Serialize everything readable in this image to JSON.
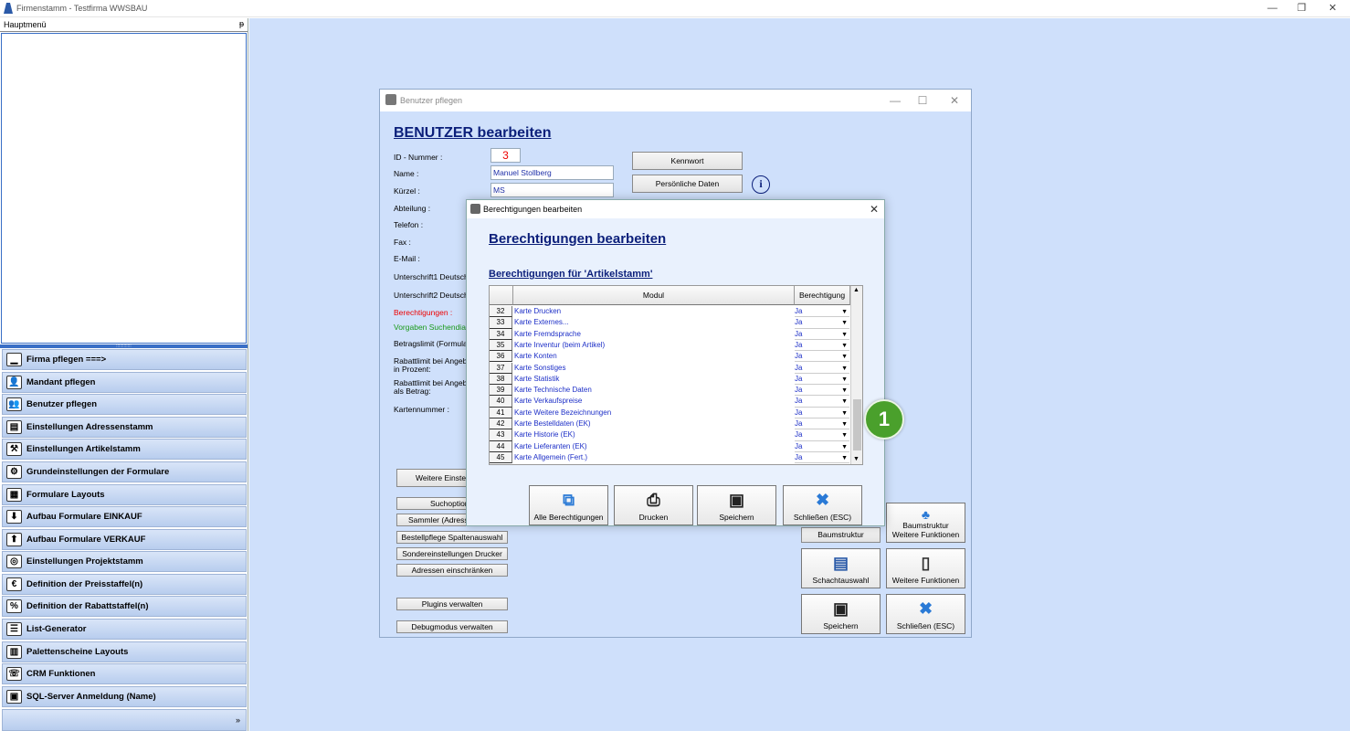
{
  "window": {
    "title": "Firmenstamm - Testfirma WWSBAU",
    "controls": [
      "—",
      "❐",
      "✕"
    ]
  },
  "left_panel": {
    "header": "Hauptmenü",
    "pin": "ᵽ",
    "grip": "::::::::::::",
    "items": [
      {
        "label": "Firma pflegen   ===>",
        "icon": "▁"
      },
      {
        "label": "Mandant pflegen",
        "icon": "👤"
      },
      {
        "label": "Benutzer pflegen",
        "icon": "👥"
      },
      {
        "label": "Einstellungen Adressenstamm",
        "icon": "▤"
      },
      {
        "label": "Einstellungen Artikelstamm",
        "icon": "⚒"
      },
      {
        "label": "Grundeinstellungen der Formulare",
        "icon": "⚙"
      },
      {
        "label": "Formulare Layouts",
        "icon": "▦"
      },
      {
        "label": "Aufbau Formulare EINKAUF",
        "icon": "⬇"
      },
      {
        "label": "Aufbau Formulare VERKAUF",
        "icon": "⬆"
      },
      {
        "label": "Einstellungen Projektstamm",
        "icon": "◎"
      },
      {
        "label": "Definition der Preisstaffel(n)",
        "icon": "€"
      },
      {
        "label": "Definition der Rabattstaffel(n)",
        "icon": "%"
      },
      {
        "label": "List-Generator",
        "icon": "☰"
      },
      {
        "label": "Palettenscheine Layouts",
        "icon": "▥"
      },
      {
        "label": "CRM Funktionen",
        "icon": "☏"
      },
      {
        "label": "SQL-Server Anmeldung (Name)",
        "icon": "▣"
      }
    ],
    "footer": "»"
  },
  "benutzer": {
    "title": "Benutzer pflegen",
    "heading": "BENUTZER bearbeiten",
    "labels": {
      "id": "ID - Nummer :",
      "name": "Name :",
      "kuerzel": "Kürzel :",
      "abteilung": "Abteilung :",
      "telefon": "Telefon :",
      "fax": "Fax :",
      "email": "E-Mail :",
      "unterschrift1": "Unterschrift1 Deutsch",
      "unterschrift2": "Unterschrift2 Deutsch",
      "berechtigungen": "Berechtigungen :",
      "vorgaben": "Vorgaben Suchendial",
      "betragslimit": "Betragslimit (Formulare",
      "rabatt1a": "Rabattlimit bei Angebo",
      "rabatt1b": "in Prozent:",
      "rabatt2a": "Rabattlimit bei Angebo",
      "rabatt2b": "als Betrag:",
      "karten": "Kartennummer :"
    },
    "values": {
      "id": "3",
      "name": "Manuel Stollberg",
      "kuerzel": "MS"
    },
    "buttons": {
      "kennwort": "Kennwort",
      "persoenlich": "Persönliche Daten",
      "weitere_einst": "Weitere Einstel",
      "suchoption": "Suchoption",
      "sammler": "Sammler (Adresse",
      "bestellpflege": "Bestellpflege Spaltenauswahl",
      "sondereinst": "Sondereinstellungen Drucker",
      "adressen": "Adressen einschränken",
      "plugins": "Plugins verwalten",
      "debug": "Debugmodus verwalten",
      "baumstruktur": "Baumstruktur",
      "baum_weitere_1": "Baumstruktur",
      "baum_weitere_2": "Weitere Funktionen",
      "schacht": "Schachtauswahl",
      "weitere_funk": "Weitere Funktionen",
      "speichern": "Speichern",
      "schliessen": "Schließen (ESC)"
    }
  },
  "dialog": {
    "title": "Berechtigungen bearbeiten",
    "heading": "Berechtigungen bearbeiten",
    "subheading": "Berechtigungen für 'Artikelstamm'",
    "columns": {
      "modul": "Modul",
      "berechtigung": "Berechtigung"
    },
    "rows": [
      {
        "nr": "32",
        "modul": "Karte Drucken",
        "perm": "Ja"
      },
      {
        "nr": "33",
        "modul": "Karte Externes...",
        "perm": "Ja"
      },
      {
        "nr": "34",
        "modul": "Karte Fremdsprache",
        "perm": "Ja"
      },
      {
        "nr": "35",
        "modul": "Karte Inventur (beim Artikel)",
        "perm": "Ja"
      },
      {
        "nr": "36",
        "modul": "Karte Konten",
        "perm": "Ja"
      },
      {
        "nr": "37",
        "modul": "Karte Sonstiges",
        "perm": "Ja"
      },
      {
        "nr": "38",
        "modul": "Karte Statistik",
        "perm": "Ja"
      },
      {
        "nr": "39",
        "modul": "Karte Technische Daten",
        "perm": "Ja"
      },
      {
        "nr": "40",
        "modul": "Karte Verkaufspreise",
        "perm": "Ja"
      },
      {
        "nr": "41",
        "modul": "Karte Weitere Bezeichnungen",
        "perm": "Ja"
      },
      {
        "nr": "42",
        "modul": "Karte Bestelldaten (EK)",
        "perm": "Ja"
      },
      {
        "nr": "43",
        "modul": "Karte Historie (EK)",
        "perm": "Ja"
      },
      {
        "nr": "44",
        "modul": "Karte Lieferanten (EK)",
        "perm": "Ja"
      },
      {
        "nr": "45",
        "modul": "Karte Allgemein (Fert.)",
        "perm": "Ja"
      }
    ],
    "buttons": {
      "alle": "Alle Berechtigungen",
      "drucken": "Drucken",
      "speichern": "Speichern",
      "schliessen": "Schließen (ESC)"
    },
    "close": "✕"
  },
  "badge": "1",
  "colors": {
    "accent": "#0b1f7a",
    "link": "#1d2fc7",
    "desktop": "#cfe0fb",
    "badge": "#4aa02c"
  }
}
